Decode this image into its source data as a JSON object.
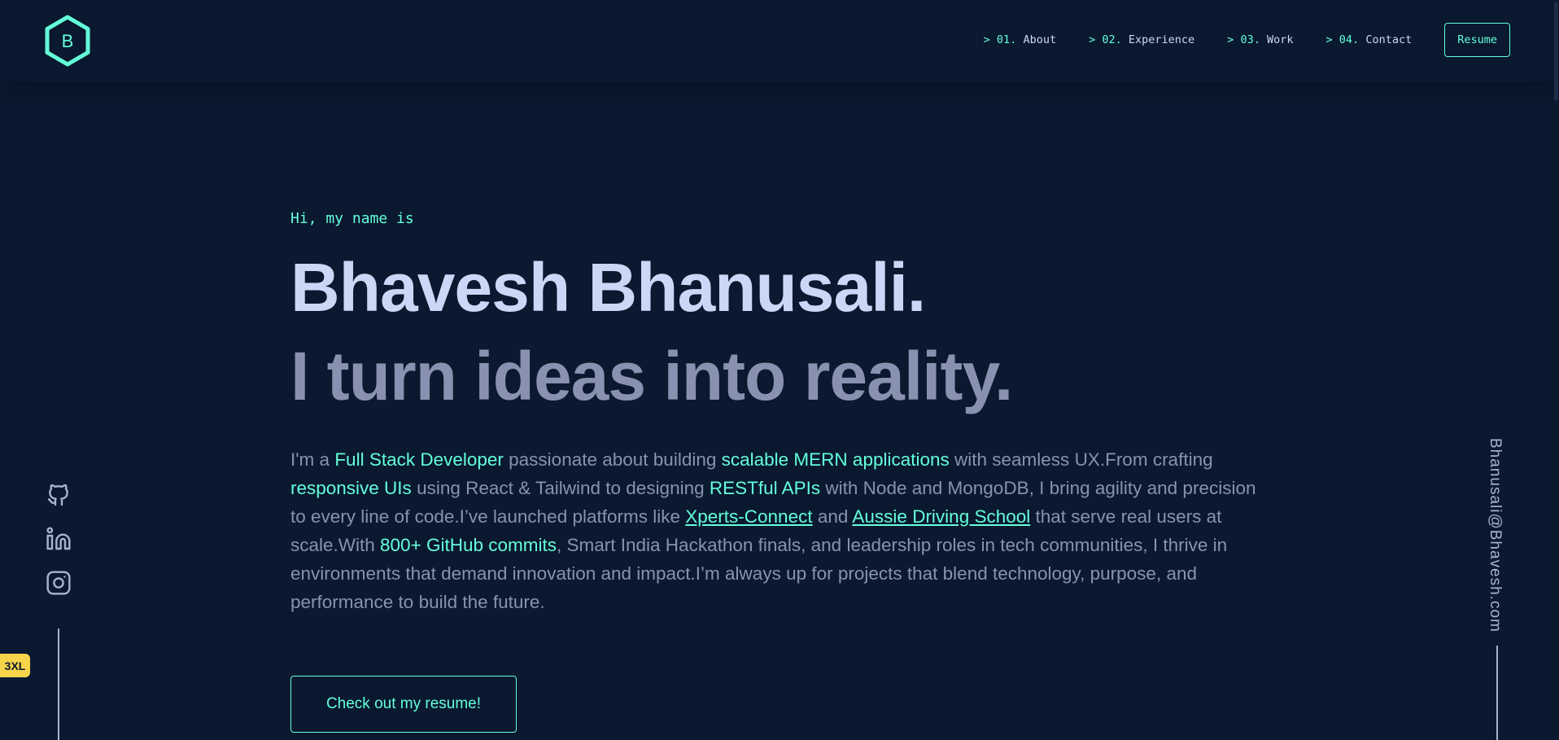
{
  "logo": {
    "letter": "B"
  },
  "nav": {
    "items": [
      {
        "num": "01.",
        "label": "About"
      },
      {
        "num": "02.",
        "label": "Experience"
      },
      {
        "num": "03.",
        "label": "Work"
      },
      {
        "num": "04.",
        "label": "Contact"
      }
    ],
    "prefix": ">",
    "resume_label": "Resume"
  },
  "hero": {
    "greeting": "Hi, my name is",
    "name": "Bhavesh Bhanusali.",
    "tagline": "I turn ideas into reality.",
    "bio": [
      {
        "t": "I'm a ",
        "s": "text"
      },
      {
        "t": "Full Stack Developer",
        "s": "hl"
      },
      {
        "t": " passionate about building ",
        "s": "text"
      },
      {
        "t": "scalable MERN applications",
        "s": "hl"
      },
      {
        "t": " with seamless UX.From crafting ",
        "s": "text"
      },
      {
        "t": "responsive UIs",
        "s": "hl"
      },
      {
        "t": " using React & Tailwind to designing ",
        "s": "text"
      },
      {
        "t": "RESTful APIs",
        "s": "hl"
      },
      {
        "t": " with Node and MongoDB, I bring agility and precision to every line of code.I’ve launched platforms like ",
        "s": "text"
      },
      {
        "t": "Xperts-Connect",
        "s": "link"
      },
      {
        "t": " and ",
        "s": "text"
      },
      {
        "t": "Aussie Driving School",
        "s": "link"
      },
      {
        "t": " that serve real users at scale.With ",
        "s": "text"
      },
      {
        "t": "800+ GitHub commits",
        "s": "hl"
      },
      {
        "t": ", Smart India Hackathon finals, and leadership roles in tech communities, I thrive in environments that demand innovation and impact.I’m always up for projects that blend technology, purpose, and performance to build the future.",
        "s": "text"
      }
    ],
    "cta_label": "Check out my resume!"
  },
  "social": [
    "github-icon",
    "linkedin-icon",
    "instagram-icon"
  ],
  "badge": "3XL",
  "email": "Bhanusali@Bhavesh.com",
  "colors": {
    "bg": "#0a192f",
    "accent": "#64ffda",
    "heading": "#ccd6f6",
    "body": "#8892b0"
  }
}
